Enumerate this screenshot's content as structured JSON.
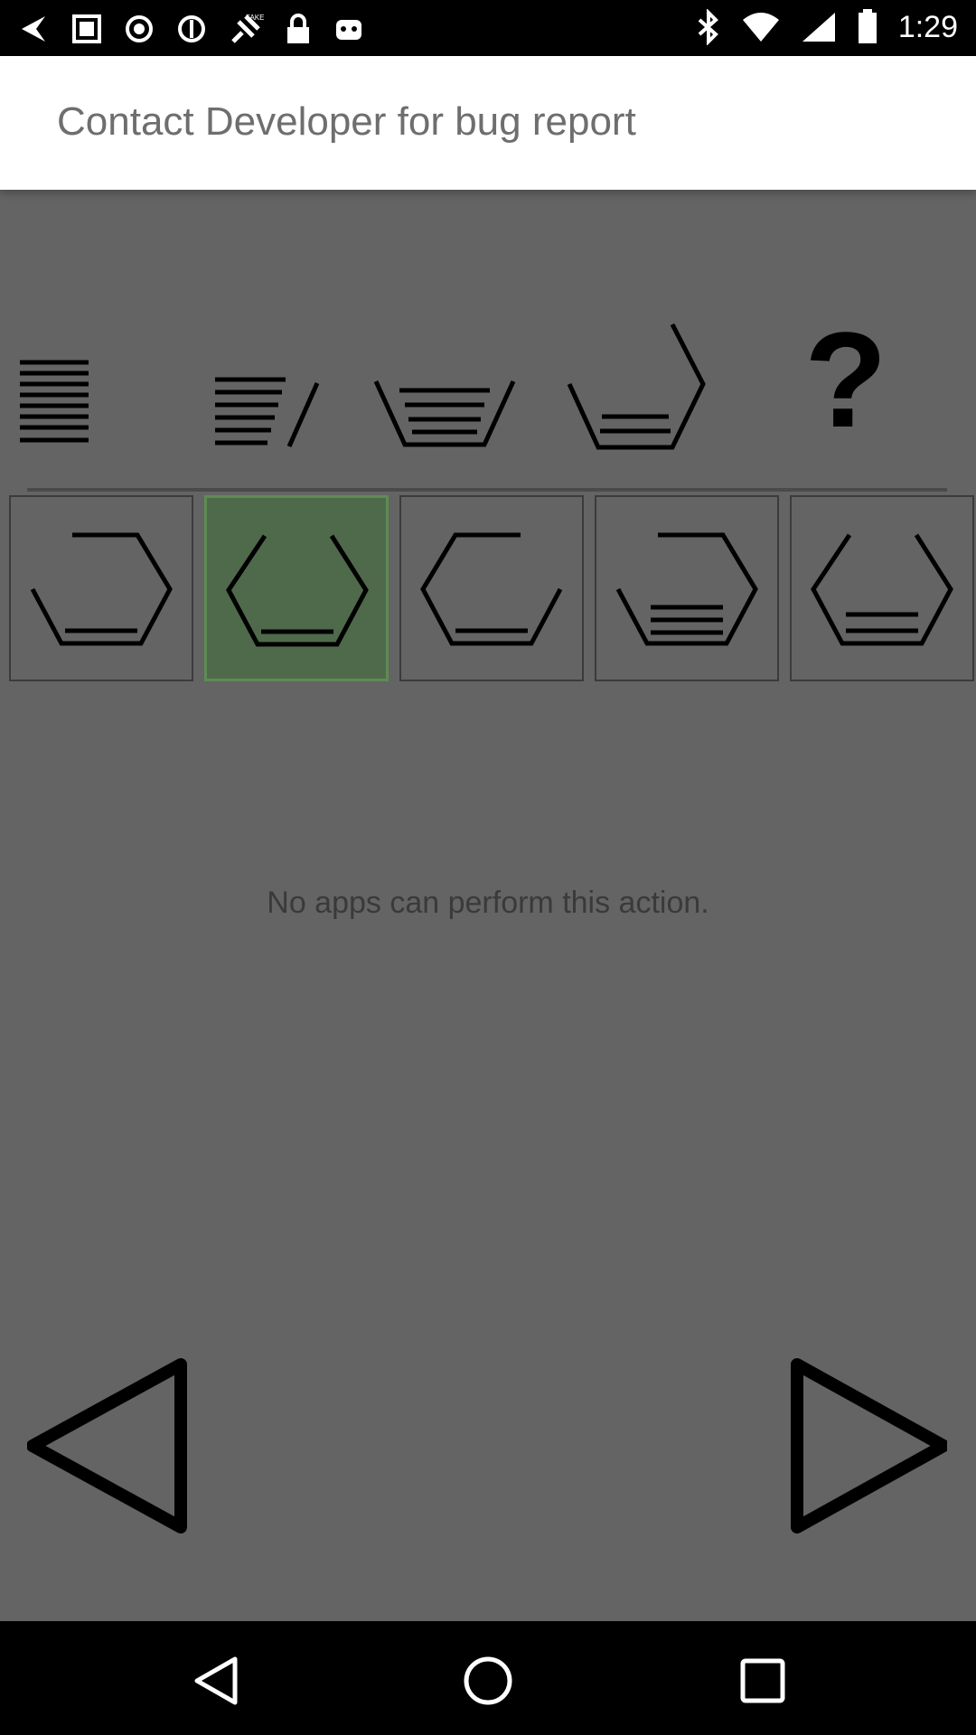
{
  "status_bar": {
    "time": "1:29",
    "icons": [
      "back-arrow-icon",
      "image-icon",
      "record-icon",
      "no-entry-icon",
      "fake-gps-satellite-icon",
      "lock-icon",
      "android-icon",
      "bluetooth-icon",
      "wifi-icon",
      "signal-icon",
      "battery-icon"
    ]
  },
  "dialog": {
    "title": "Contact Developer for bug report"
  },
  "puzzle": {
    "sequence_icons": [
      "lines-4-icon",
      "lines-3-slash-icon",
      "basket-lines-icon",
      "basket-lines-open-icon",
      "question-mark-icon"
    ],
    "question_mark": "?",
    "choices": [
      {
        "icon": "hexagon-open-left-icon",
        "selected": false
      },
      {
        "icon": "hexagon-open-top-icon",
        "selected": true
      },
      {
        "icon": "hexagon-open-right-icon",
        "selected": false
      },
      {
        "icon": "hexagon-lines-icon",
        "selected": false
      },
      {
        "icon": "hexagon-line-icon",
        "selected": false
      }
    ]
  },
  "message": "No apps can perform this action.",
  "nav": {
    "prev": "prev-arrow-icon",
    "next": "next-arrow-icon"
  },
  "system_nav": [
    "back-icon",
    "home-icon",
    "recents-icon"
  ]
}
